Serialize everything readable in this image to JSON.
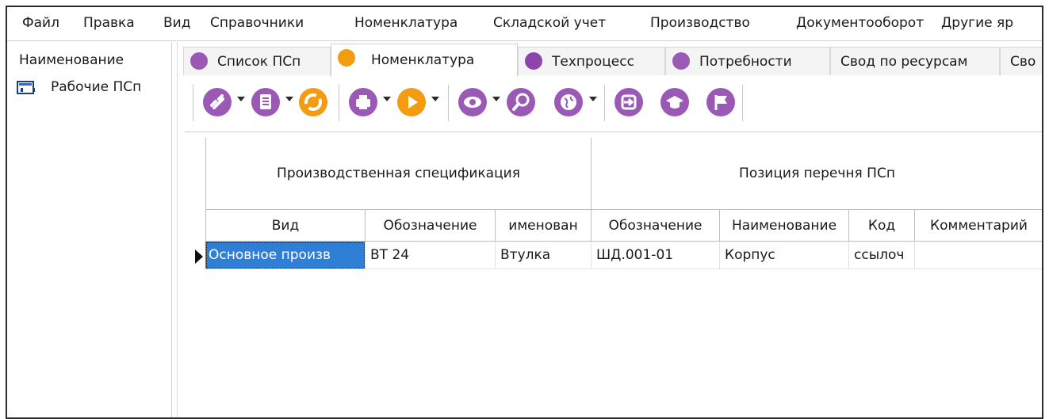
{
  "menu": {
    "items": [
      "Файл",
      "Правка",
      "Вид",
      "Справочники",
      "Номенклатура",
      "Складской учет",
      "Производство",
      "Документооборот",
      "Другие яр"
    ]
  },
  "left_panel": {
    "header": "Наименование",
    "item_label": "Рабочие ПСп"
  },
  "tabs": [
    {
      "label": "Список ПСп",
      "icon": "puzzle-icon",
      "color": "#9b59b6"
    },
    {
      "label": "Номенклатура",
      "icon": "document-icon",
      "color": "#f39c12"
    },
    {
      "label": "Техпроцесс",
      "icon": "gears-icon",
      "color": "#8e44ad"
    },
    {
      "label": "Потребности",
      "icon": "tag-icon",
      "color": "#9b59b6"
    },
    {
      "label": "Свод по ресурсам",
      "icon": "",
      "color": ""
    },
    {
      "label": "Сво",
      "icon": "",
      "color": ""
    }
  ],
  "toolbar": {
    "buttons": [
      {
        "icon": "link-icon",
        "color": "#9b59b6"
      },
      {
        "icon": "document-icon",
        "color": "#9b59b6"
      },
      {
        "icon": "refresh-icon",
        "color": "#f39c12"
      },
      {
        "icon": "printer-icon",
        "color": "#9b59b6"
      },
      {
        "icon": "play-icon",
        "color": "#f39c12"
      },
      {
        "icon": "eye-icon",
        "color": "#9b59b6"
      },
      {
        "icon": "search-icon",
        "color": "#9b59b6"
      },
      {
        "icon": "globe-icon",
        "color": "#9b59b6"
      },
      {
        "icon": "enter-icon",
        "color": "#9b59b6"
      },
      {
        "icon": "graduation-cap-icon",
        "color": "#9b59b6"
      },
      {
        "icon": "flag-icon",
        "color": "#9b59b6"
      }
    ]
  },
  "grid": {
    "bands": [
      "Производственная спецификация",
      "Позиция перечня ПСп"
    ],
    "columns": [
      "Вид",
      "Обозначение",
      "именован",
      "Обозначение",
      "Наименование",
      "Код",
      "Комментарий"
    ],
    "rows": [
      [
        "Основное произв",
        "ВТ 24",
        "Втулка",
        "ШД.001-01",
        "Корпус",
        "ссылоч",
        ""
      ]
    ]
  },
  "colors": {
    "accent_purple": "#9b59b6",
    "accent_orange": "#f39c12",
    "selection_blue": "#2f7fd6"
  }
}
